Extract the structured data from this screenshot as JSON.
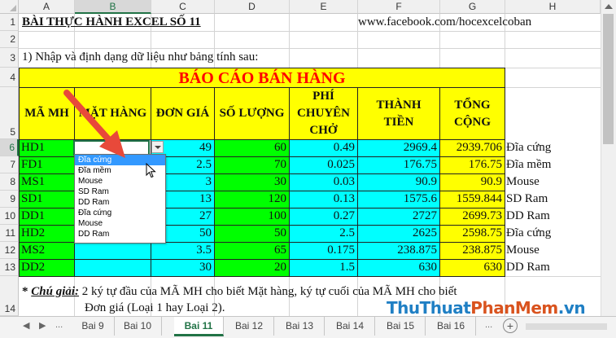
{
  "columns": [
    "A",
    "B",
    "C",
    "D",
    "E",
    "F",
    "G",
    "H"
  ],
  "selected_column": "B",
  "rows": [
    "1",
    "2",
    "3",
    "4",
    "5",
    "6",
    "7",
    "8",
    "9",
    "10",
    "11",
    "12",
    "13",
    "14"
  ],
  "selected_row": "6",
  "sheet": {
    "title": "BÀI THỰC HÀNH EXCEL SỐ 11",
    "url": "www.facebook.com/hocexcelcoban",
    "instruction": "1) Nhập và định dạng dữ liệu như bảng tính sau:",
    "report_title": "BÁO CÁO BÁN HÀNG",
    "headers": [
      "MÃ MH",
      "MẶT HÀNG",
      "ĐƠN GIÁ",
      "SỐ LƯỢNG",
      "PHÍ CHUYÊN CHỞ",
      "THÀNH TIỀN",
      "TỔNG CỘNG"
    ],
    "data": [
      {
        "ma": "HD1",
        "mh": "",
        "dg": "49",
        "sl": "60",
        "phi": "0.49",
        "tt": "2969.4",
        "tc": "2939.706",
        "ext": "Đĩa cứng"
      },
      {
        "ma": "FD1",
        "mh": "",
        "dg": "2.5",
        "sl": "70",
        "phi": "0.025",
        "tt": "176.75",
        "tc": "176.75",
        "ext": "Đĩa mềm"
      },
      {
        "ma": "MS1",
        "mh": "",
        "dg": "3",
        "sl": "30",
        "phi": "0.03",
        "tt": "90.9",
        "tc": "90.9",
        "ext": "Mouse"
      },
      {
        "ma": "SD1",
        "mh": "",
        "dg": "13",
        "sl": "120",
        "phi": "0.13",
        "tt": "1575.6",
        "tc": "1559.844",
        "ext": "SD Ram"
      },
      {
        "ma": "DD1",
        "mh": "",
        "dg": "27",
        "sl": "100",
        "phi": "0.27",
        "tt": "2727",
        "tc": "2699.73",
        "ext": "DD Ram"
      },
      {
        "ma": "HD2",
        "mh": "",
        "dg": "50",
        "sl": "50",
        "phi": "2.5",
        "tt": "2625",
        "tc": "2598.75",
        "ext": "Đĩa cứng"
      },
      {
        "ma": "MS2",
        "mh": "",
        "dg": "3.5",
        "sl": "65",
        "phi": "0.175",
        "tt": "238.875",
        "tc": "238.875",
        "ext": "Mouse"
      },
      {
        "ma": "DD2",
        "mh": "",
        "dg": "30",
        "sl": "20",
        "phi": "1.5",
        "tt": "630",
        "tc": "630",
        "ext": "DD Ram"
      }
    ],
    "note_label": "Chú giải:",
    "note_star": "*",
    "note_line1": "2 ký tự đầu của MÃ MH cho biết Mặt hàng, ký tự cuối của MÃ MH cho biết",
    "note_line2": "Đơn giá (Loại 1 hay Loại 2)."
  },
  "dropdown": {
    "items": [
      "Đĩa cứng",
      "Đĩa mềm",
      "Mouse",
      "SD Ram",
      "DD Ram",
      "Đĩa cứng",
      "Mouse",
      "DD Ram"
    ],
    "highlighted_index": 0
  },
  "tabs": {
    "items": [
      "Bai 9",
      "Bai 10",
      "Bai 11",
      "Bai 12",
      "Bai 13",
      "Bai 14",
      "Bai 15",
      "Bai 16"
    ],
    "active": "Bai 11",
    "more": "...",
    "add": "+"
  },
  "watermark": {
    "part1": "ThuThuat",
    "part2": "PhanMem",
    "part3": ".vn"
  },
  "colors": {
    "header_yellow": "#ffff00",
    "cyan": "#00ffff",
    "green": "#00ff00",
    "report_red": "#ff0000",
    "arrow": "#e8493a"
  }
}
